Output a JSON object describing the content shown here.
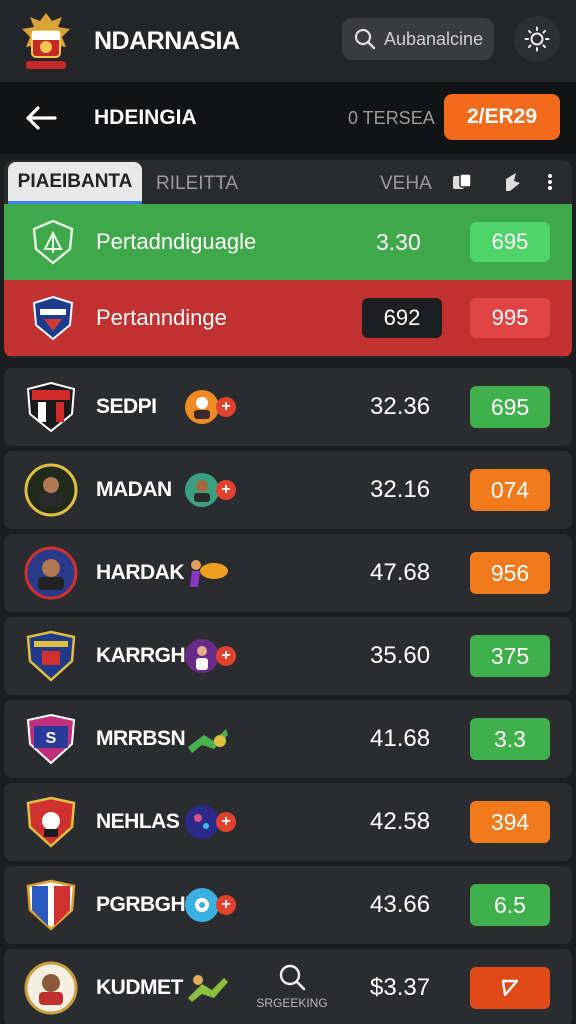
{
  "header": {
    "app_title": "NDARNASIA",
    "search_text": "Aubanalcine"
  },
  "subheader": {
    "title": "HDEINGIA",
    "meta": "0 TERSEA",
    "action_label": "2/ER29"
  },
  "tabs": {
    "active": "PIAEIBANTA",
    "second": "RILEITTA",
    "third": "VEHA"
  },
  "highlights": [
    {
      "name": "Pertadndiguagle",
      "value": "3.30",
      "badge": "695",
      "color": "green"
    },
    {
      "name": "Pertanndinge",
      "value": "692",
      "badge": "995",
      "color": "red"
    }
  ],
  "rows": [
    {
      "name": "SEDPI",
      "value": "32.36",
      "badge": "695",
      "badge_color": "#3fb04c"
    },
    {
      "name": "MADAN",
      "value": "32.16",
      "badge": "074",
      "badge_color": "#f07a1c"
    },
    {
      "name": "HARDAK",
      "value": "47.68",
      "badge": "956",
      "badge_color": "#f07a1c"
    },
    {
      "name": "KARRGH",
      "value": "35.60",
      "badge": "375",
      "badge_color": "#3fb04c"
    },
    {
      "name": "MRRBSN",
      "value": "41.68",
      "badge": "3.3",
      "badge_color": "#3fb04c"
    },
    {
      "name": "NEHLAS",
      "value": "42.58",
      "badge": "394",
      "badge_color": "#f07a1c"
    },
    {
      "name": "PGRBGHI",
      "value": "43.66",
      "badge": "6.5",
      "badge_color": "#3fb04c"
    },
    {
      "name": "KUDMET",
      "value": "$3.37",
      "badge": "",
      "badge_color": "#e04a18"
    }
  ],
  "bottom_search_label": "SRGEEKING",
  "colors": {
    "accent_orange": "#f26a1b",
    "green": "#3fa84a",
    "red": "#c0312f",
    "background": "#1c1d20"
  }
}
